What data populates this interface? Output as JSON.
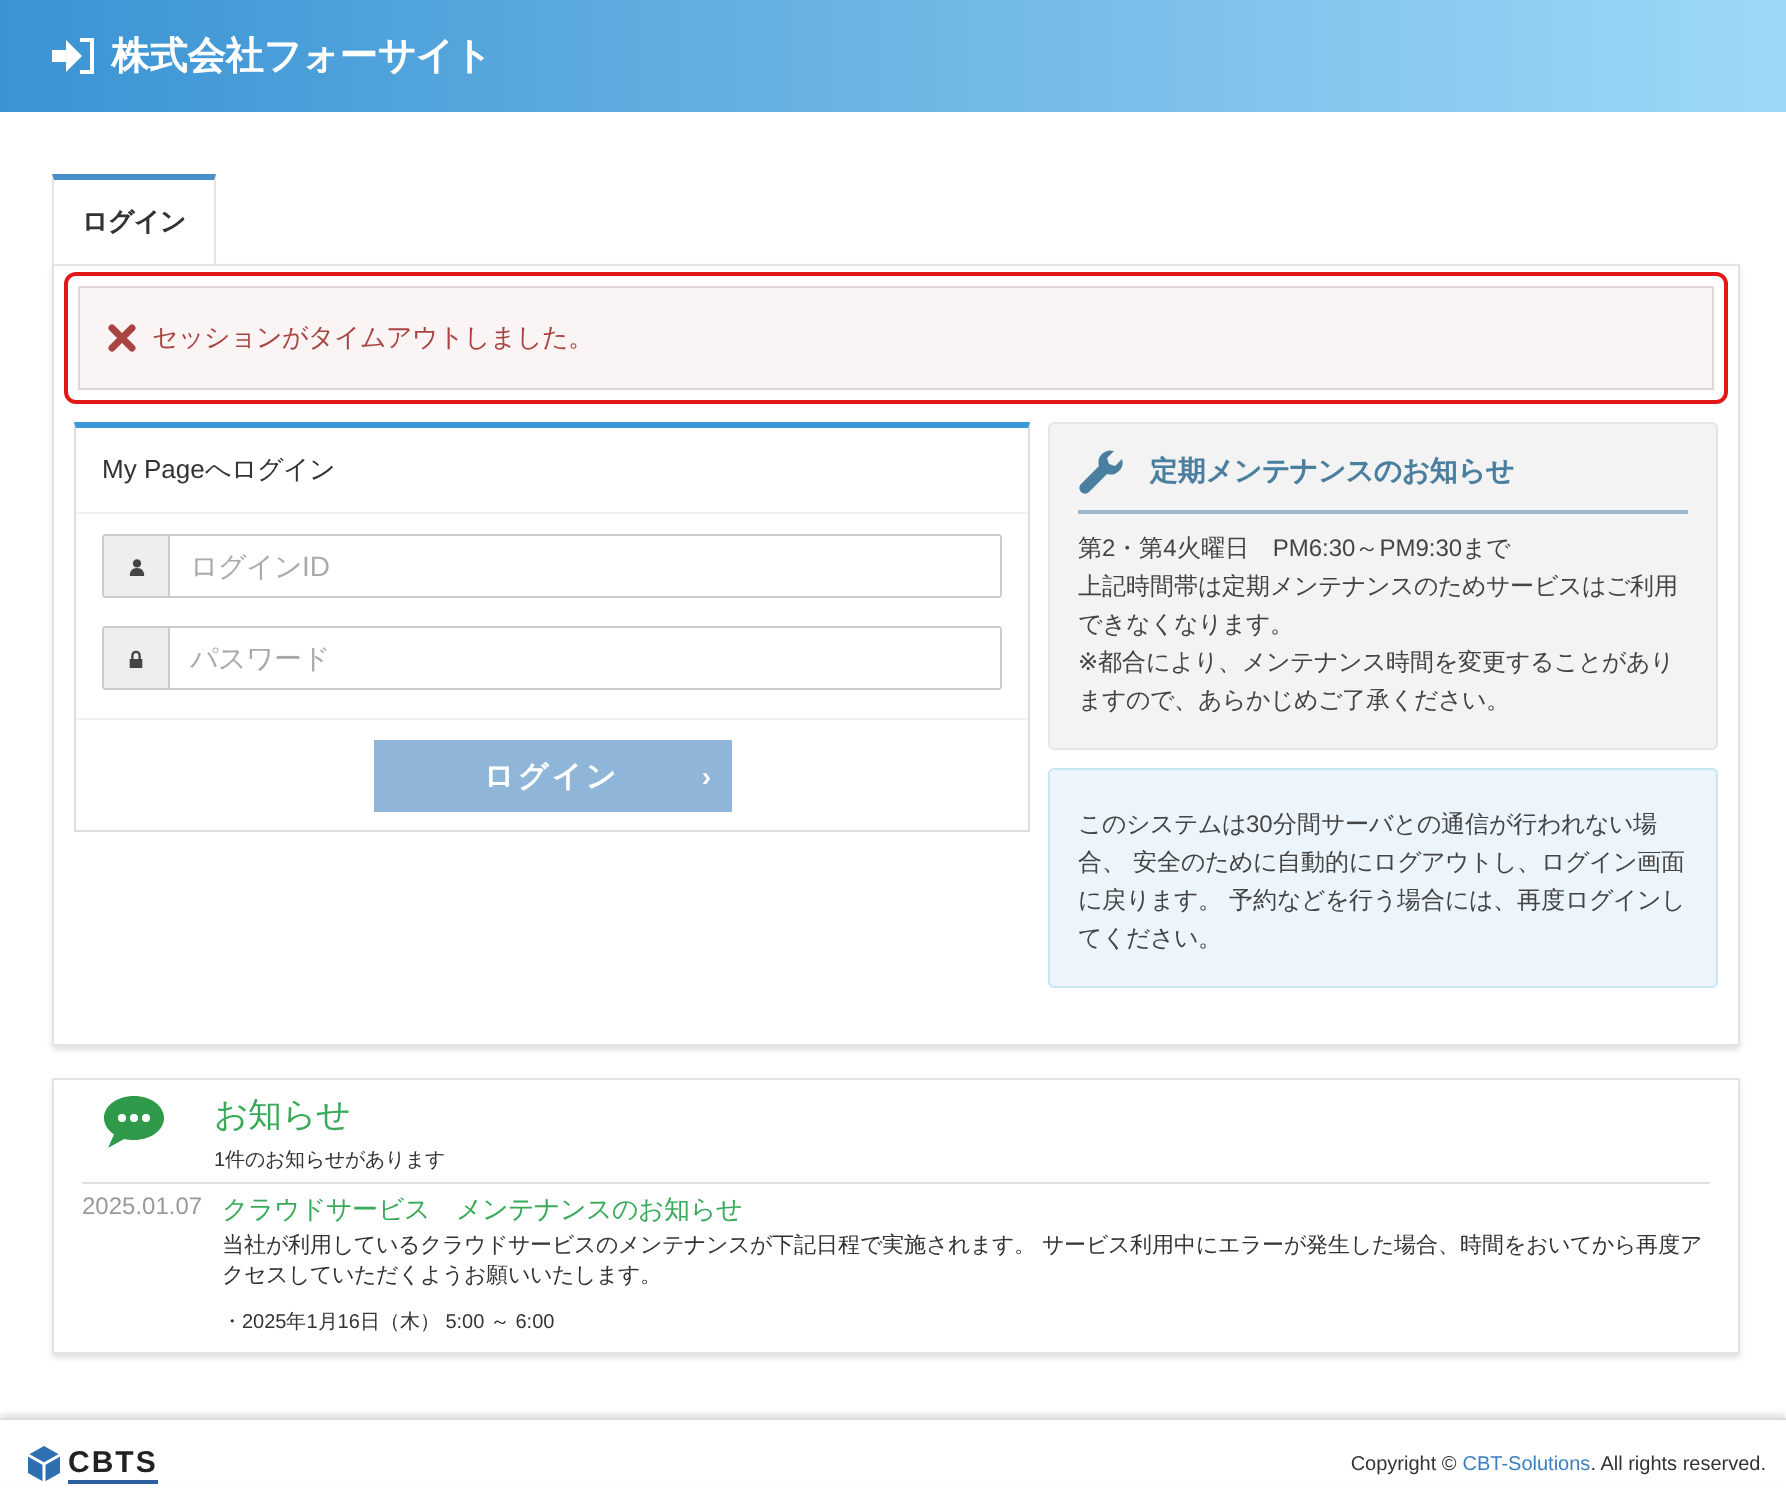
{
  "header": {
    "title": "株式会社フォーサイト"
  },
  "tabs": [
    {
      "label": "ログイン",
      "selected": true
    }
  ],
  "alert": {
    "message": "セッションがタイムアウトしました。"
  },
  "login": {
    "title": "My Pageへログイン",
    "fields": [
      {
        "kind": "user",
        "placeholder": "ログインID"
      },
      {
        "kind": "lock",
        "placeholder": "パスワード"
      }
    ],
    "button": {
      "label": "ログイン",
      "arrow": "›",
      "disabled": true
    }
  },
  "maintenance": {
    "title": "定期メンテナンスのお知らせ",
    "lines": [
      "第2・第4火曜日　PM6:30～PM9:30まで",
      "上記時間帯は定期メンテナンスのためサービスはご利用できなくなります。",
      "※都合により、メンテナンス時間を変更することがありますので、あらかじめご了承ください。"
    ]
  },
  "info": {
    "text": "このシステムは30分間サーバとの通信が行われない場合、 安全のために自動的にログアウトし、ログイン画面に戻ります。 予約などを行う場合には、再度ログインしてください。"
  },
  "news": {
    "title": "お知らせ",
    "count": "1件のお知らせがあります",
    "items": [
      {
        "date": "2025.01.07",
        "title": "クラウドサービス　メンテナンスのお知らせ",
        "body": "当社が利用しているクラウドサービスのメンテナンスが下記日程で実施されます。 サービス利用中にエラーが発生した場合、時間をおいてから再度アクセスしていただくようお願いいたします。",
        "note": "・2025年1月16日（木） 5:00 ～ 6:00"
      }
    ]
  },
  "footer": {
    "logo": "CBTS",
    "copyright_prefix": "Copyright ©",
    "link": "CBT-Solutions",
    "copyright_suffix": ". All rights reserved."
  }
}
